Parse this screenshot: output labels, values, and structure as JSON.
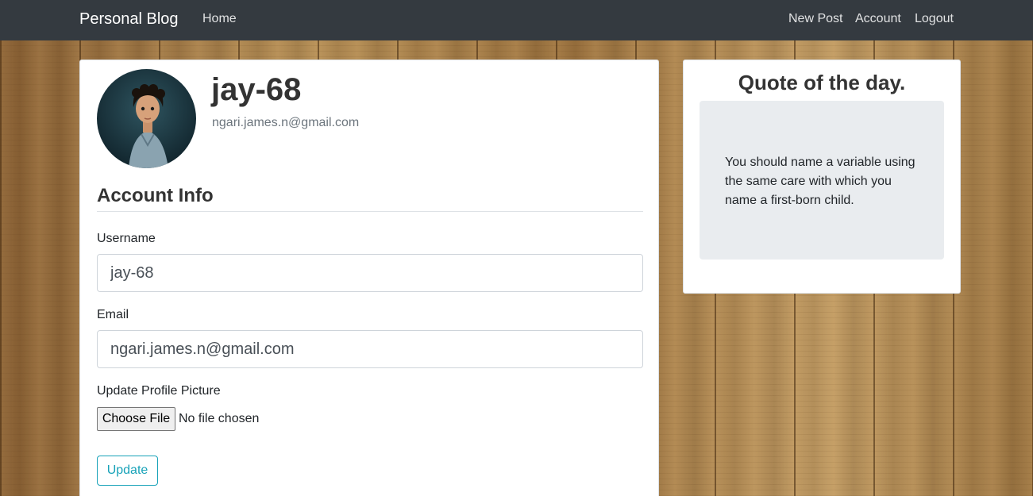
{
  "navbar": {
    "brand": "Personal Blog",
    "left_links": [
      {
        "label": "Home"
      }
    ],
    "right_links": [
      {
        "label": "New Post"
      },
      {
        "label": "Account"
      },
      {
        "label": "Logout"
      }
    ]
  },
  "profile": {
    "username": "jay-68",
    "email": "ngari.james.n@gmail.com"
  },
  "account_form": {
    "section_title": "Account Info",
    "username_label": "Username",
    "username_value": "jay-68",
    "email_label": "Email",
    "email_value": "ngari.james.n@gmail.com",
    "picture_label": "Update Profile Picture",
    "file_button_label": "Choose File",
    "file_status": "No file chosen",
    "submit_label": "Update"
  },
  "quote_card": {
    "title": "Quote of the day.",
    "text": "You should name a variable using the same care with which you name a first-born child."
  },
  "colors": {
    "navbar_bg": "#343a40",
    "accent_info": "#17a2b8",
    "quote_bg": "#e9ecef"
  }
}
